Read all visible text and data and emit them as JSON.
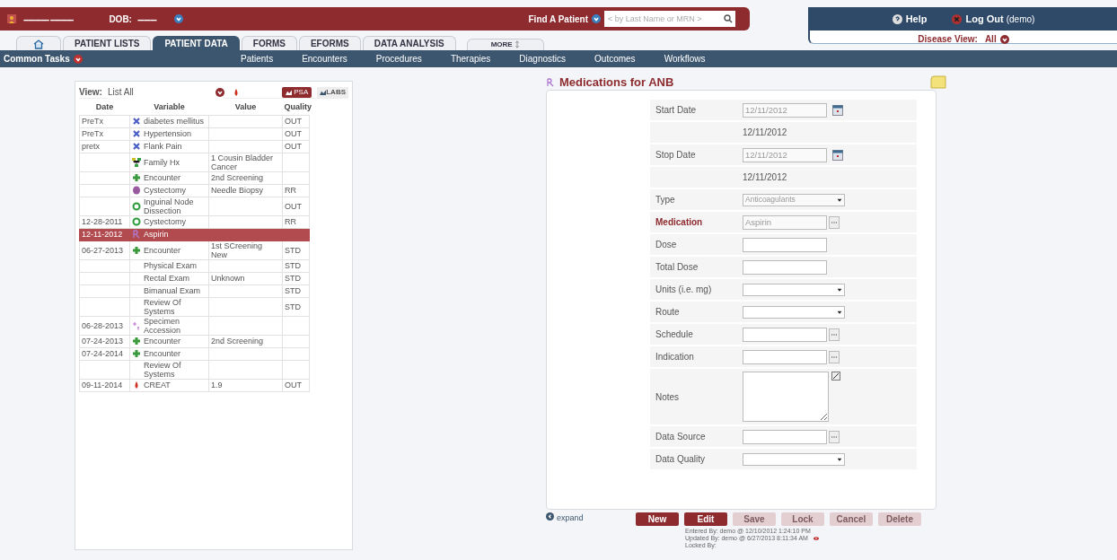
{
  "header": {
    "patient_name": "------------ -----------",
    "dob_label": "DOB:",
    "dob_value": "---------"
  },
  "find_patient": {
    "label": "Find A Patient",
    "placeholder": "< by Last Name or MRN >"
  },
  "user_menu": {
    "help": "Help",
    "logout": "Log Out",
    "user": "(demo)",
    "disease_view_label": "Disease View:",
    "disease_view_value": "All"
  },
  "tabs": [
    {
      "kind": "home",
      "selected": false
    },
    {
      "kind": "text",
      "label": "PATIENT LISTS",
      "selected": false
    },
    {
      "kind": "text",
      "label": "PATIENT DATA",
      "selected": true
    },
    {
      "kind": "text",
      "label": "FORMS",
      "selected": false
    },
    {
      "kind": "text",
      "label": "EFORMS",
      "selected": false
    },
    {
      "kind": "text",
      "label": "DATA ANALYSIS",
      "selected": false
    },
    {
      "kind": "more",
      "label": "MORE",
      "selected": false
    }
  ],
  "common_tasks": "Common Tasks",
  "nav_links": [
    "Patients",
    "Encounters",
    "Procedures",
    "Therapies",
    "Diagnostics",
    "Outcomes",
    "Workflows"
  ],
  "data_list": {
    "view_label": "View:",
    "view_value": "List All",
    "psa": "PSA",
    "labs": "LABS",
    "columns": [
      "Date",
      "Variable",
      "Value",
      "Quality"
    ],
    "rows": [
      {
        "date": "PreTx",
        "kind": "diagnosis",
        "variable": "diabetes mellitus",
        "quality": "OUT",
        "selected": false
      },
      {
        "date": "PreTx",
        "kind": "diagnosis",
        "variable": "Hypertension",
        "quality": "OUT",
        "selected": false
      },
      {
        "date": "pretx",
        "kind": "diagnosis",
        "variable": "Flank Pain",
        "quality": "OUT",
        "selected": false
      },
      {
        "kind": "family",
        "variable": "Family Hx",
        "value": "1 Cousin Bladder Cancer",
        "selected": false
      },
      {
        "kind": "encounter",
        "variable": "Encounter",
        "value": "2nd Screening",
        "selected": false
      },
      {
        "kind": "pathology",
        "variable": "Cystectomy",
        "value": "Needle Biopsy",
        "quality": "RR",
        "selected": false
      },
      {
        "kind": "procedure",
        "variable": "Inguinal Node Dissection",
        "quality": "OUT",
        "selected": false
      },
      {
        "date": "12-28-2011",
        "kind": "procedure",
        "variable": "Cystectomy",
        "quality": "RR",
        "selected": false
      },
      {
        "date": "12-11-2012",
        "kind": "medication",
        "variable": "Aspirin",
        "selected": true
      },
      {
        "date": "06-27-2013",
        "kind": "encounter",
        "variable": "Encounter",
        "value": "1st SCreening New",
        "quality": "STD",
        "selected": false
      },
      {
        "kind": "exam",
        "variable": "Physical Exam",
        "quality": "STD",
        "selected": false
      },
      {
        "kind": "exam",
        "variable": "Rectal Exam",
        "value": "Unknown",
        "quality": "STD",
        "selected": false
      },
      {
        "kind": "exam",
        "variable": "Bimanual Exam",
        "quality": "STD",
        "selected": false
      },
      {
        "kind": "exam",
        "variable": "Review Of Systems",
        "quality": "STD",
        "selected": false
      },
      {
        "date": "06-28-2013",
        "kind": "specimen",
        "variable": "Specimen Accession",
        "selected": false
      },
      {
        "date": "07-24-2013",
        "kind": "encounter",
        "variable": "Encounter",
        "value": "2nd Screening",
        "selected": false
      },
      {
        "date": "07-24-2014",
        "kind": "encounter",
        "variable": "Encounter",
        "selected": false
      },
      {
        "kind": "exam",
        "variable": "Review Of Systems",
        "selected": false
      },
      {
        "date": "09-11-2014",
        "kind": "lab",
        "variable": "CREAT",
        "value": "1.9",
        "quality": "OUT",
        "selected": false
      }
    ]
  },
  "form": {
    "title": "Medications for ANB",
    "fields": [
      {
        "kind": "date",
        "label": "Start Date",
        "value": "12/11/2012",
        "required": false,
        "disabled": true
      },
      {
        "kind": "display",
        "value": "12/11/2012"
      },
      {
        "kind": "date",
        "label": "Stop Date",
        "value": "12/11/2012",
        "required": false,
        "disabled": true
      },
      {
        "kind": "display",
        "value": "12/11/2012"
      },
      {
        "kind": "select",
        "label": "Type",
        "value": "Anticoagulants",
        "required": false,
        "disabled": true
      },
      {
        "kind": "lookup",
        "label": "Medication",
        "value": "Aspirin",
        "required": true,
        "disabled": true
      },
      {
        "kind": "text",
        "label": "Dose",
        "required": false
      },
      {
        "kind": "text",
        "label": "Total Dose",
        "required": false
      },
      {
        "kind": "select",
        "label": "Units (i.e. mg)",
        "required": false
      },
      {
        "kind": "select",
        "label": "Route",
        "required": false
      },
      {
        "kind": "lookup",
        "label": "Schedule",
        "required": false
      },
      {
        "kind": "lookup",
        "label": "Indication",
        "required": false
      },
      {
        "kind": "textarea",
        "label": "Notes",
        "required": false
      },
      {
        "kind": "lookup",
        "label": "Data Source",
        "required": false
      },
      {
        "kind": "select",
        "label": "Data Quality",
        "required": false
      }
    ],
    "expand": "expand",
    "buttons": [
      {
        "label": "New",
        "disabled": false
      },
      {
        "label": "Edit",
        "disabled": false
      },
      {
        "label": "Save",
        "disabled": true
      },
      {
        "label": "Lock",
        "disabled": true
      },
      {
        "label": "Cancel",
        "disabled": true
      },
      {
        "label": "Delete",
        "disabled": true
      }
    ],
    "audit": [
      "Entered By: demo @ 12/10/2012 1:24:10 PM",
      "Updated By: demo @ 6/27/2013 8:11:34 AM",
      "Locked By:"
    ]
  }
}
